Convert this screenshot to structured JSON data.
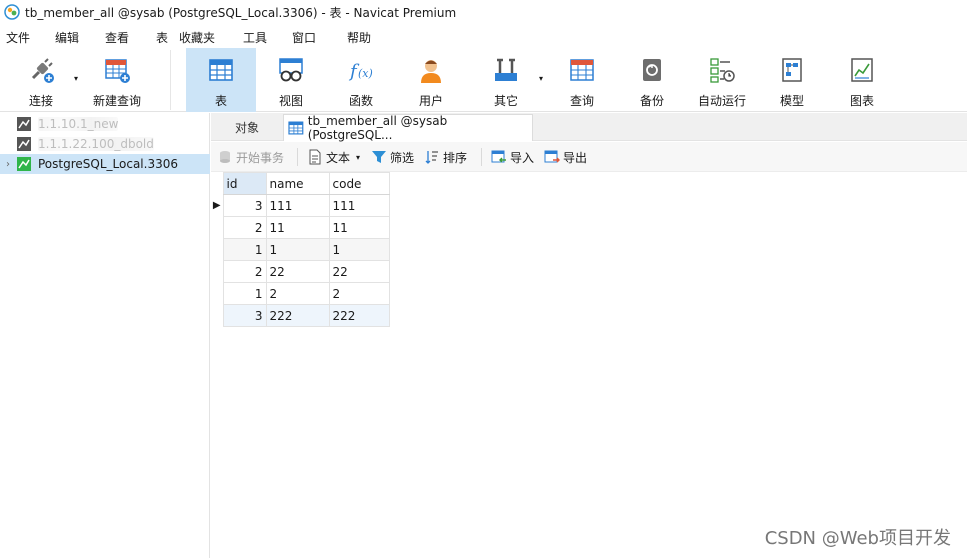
{
  "window": {
    "title": "tb_member_all @sysab (PostgreSQL_Local.3306) - 表 - Navicat Premium"
  },
  "menu": [
    "文件",
    "编辑",
    "查看",
    "表",
    "收藏夹",
    "工具",
    "窗口",
    "帮助"
  ],
  "toolbar": {
    "connect": "连接",
    "new_query": "新建查询",
    "table": "表",
    "view": "视图",
    "function": "函数",
    "user": "用户",
    "other": "其它",
    "query": "查询",
    "backup": "备份",
    "automation": "自动运行",
    "model": "模型",
    "chart": "图表"
  },
  "sidebar": {
    "connections": [
      {
        "label": "1.1.10.1_new"
      },
      {
        "label": "1.1.1.22.100_dbold"
      },
      {
        "label": "PostgreSQL_Local.3306"
      }
    ]
  },
  "tabs": {
    "objects": "对象",
    "current": "tb_member_all @sysab (PostgreSQL..."
  },
  "subtoolbar": {
    "begin_transaction": "开始事务",
    "text": "文本",
    "filter": "筛选",
    "sort": "排序",
    "import": "导入",
    "export": "导出"
  },
  "grid": {
    "columns": [
      "id",
      "name",
      "code"
    ],
    "rows": [
      [
        "3",
        "111",
        "111"
      ],
      [
        "2",
        "11",
        "11"
      ],
      [
        "1",
        "1",
        "1"
      ],
      [
        "2",
        "22",
        "22"
      ],
      [
        "1",
        "2",
        "2"
      ],
      [
        "3",
        "222",
        "222"
      ]
    ]
  },
  "watermark": "CSDN @Web项目开发"
}
